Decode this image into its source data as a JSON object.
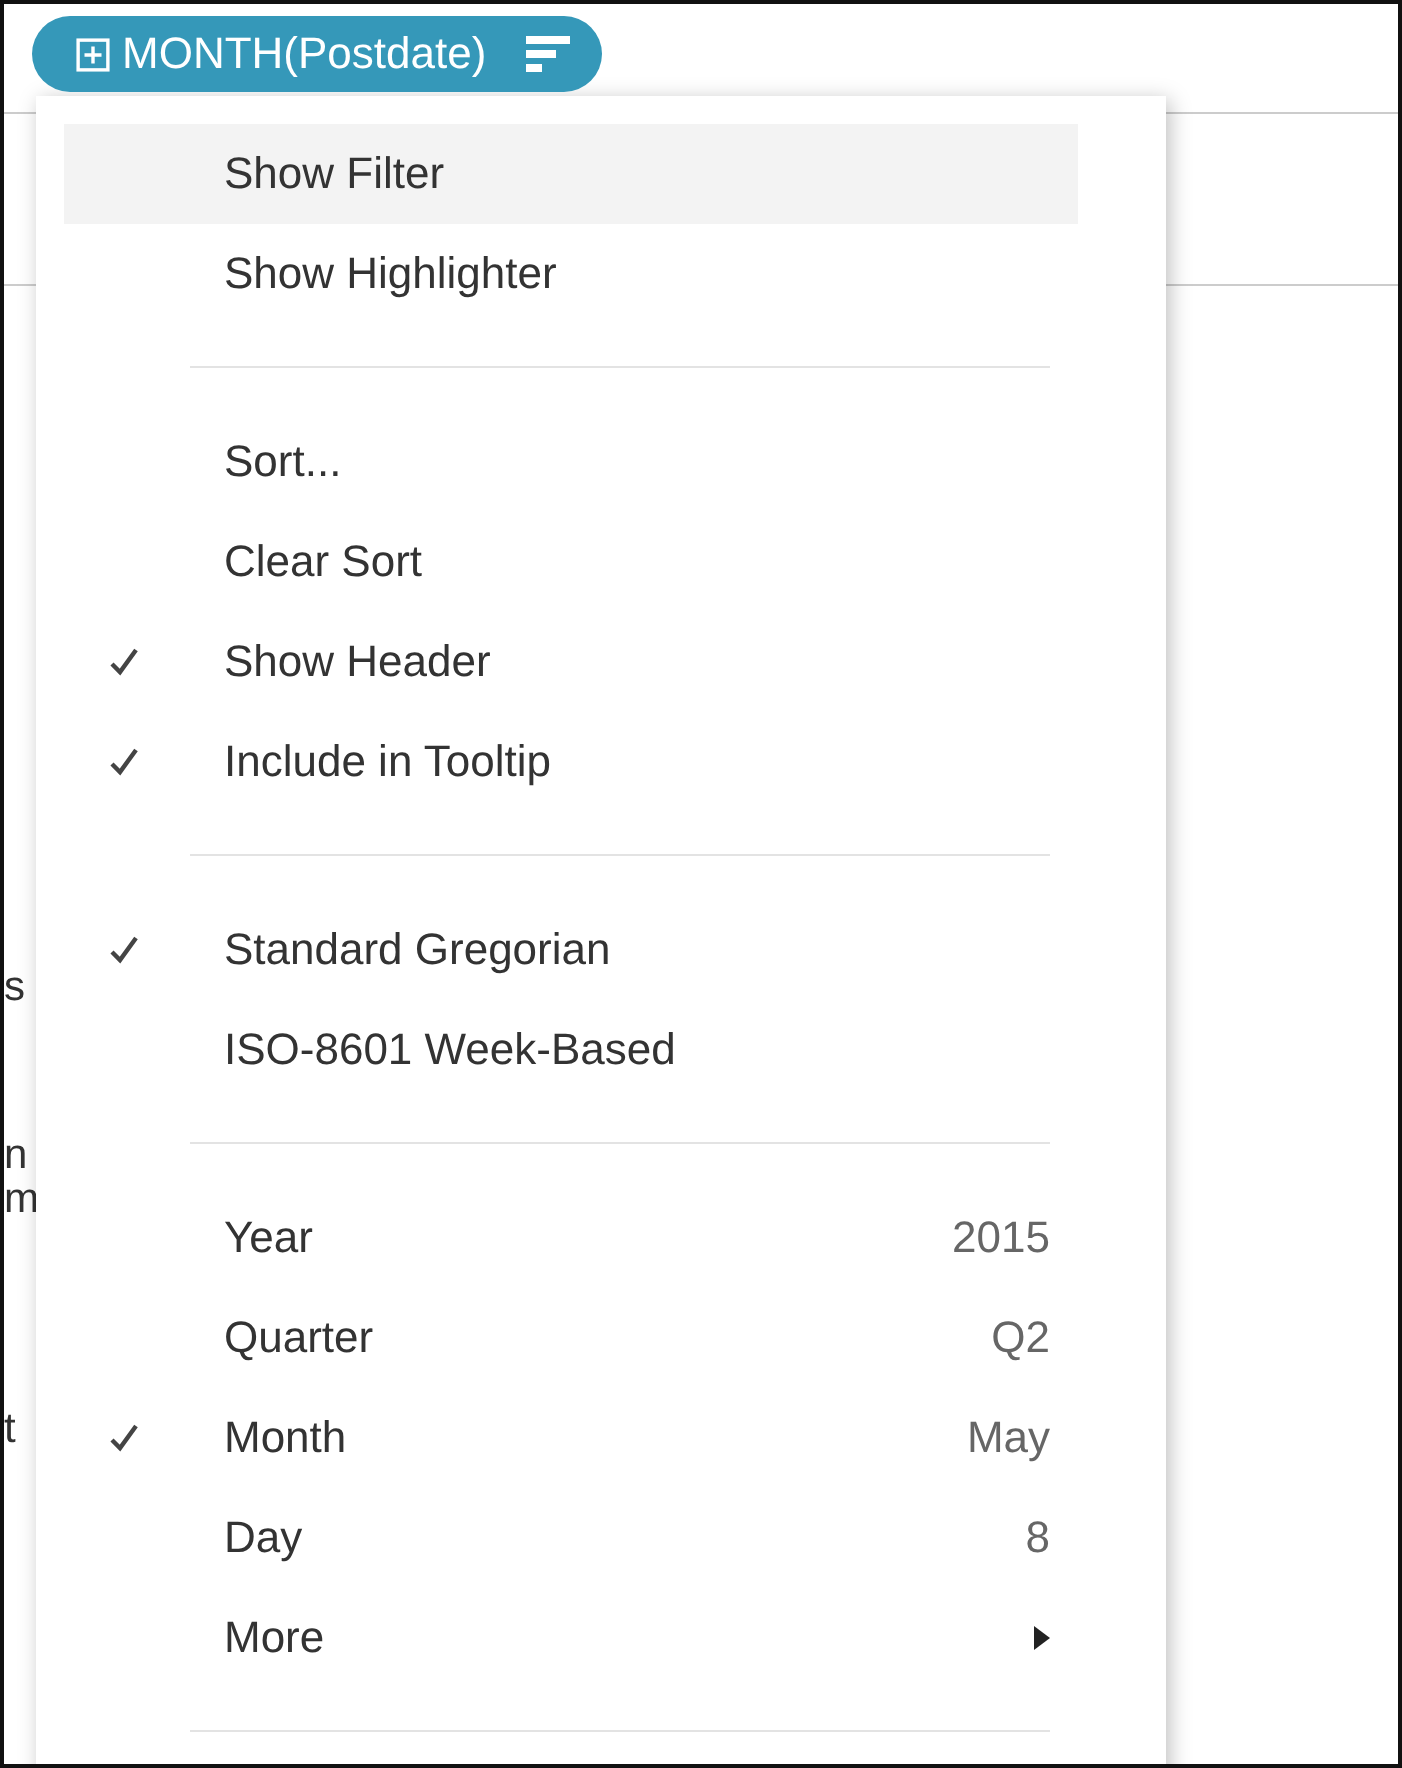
{
  "pill": {
    "label": "MONTH(Postdate)"
  },
  "background_fragments": [
    {
      "text": "s"
    },
    {
      "text": "n"
    },
    {
      "text": "m"
    },
    {
      "text": "t"
    }
  ],
  "menu": {
    "sections": [
      [
        {
          "label": "Show Filter",
          "kind": "option",
          "checked": false,
          "highlighted": true
        },
        {
          "label": "Show Highlighter",
          "kind": "option",
          "checked": false,
          "highlighted": false
        }
      ],
      [
        {
          "label": "Sort...",
          "kind": "option",
          "checked": false,
          "highlighted": false
        },
        {
          "label": "Clear Sort",
          "kind": "option",
          "checked": false,
          "highlighted": false
        },
        {
          "label": "Show Header",
          "kind": "option",
          "checked": true,
          "highlighted": false
        },
        {
          "label": "Include in Tooltip",
          "kind": "option",
          "checked": true,
          "highlighted": false
        }
      ],
      [
        {
          "label": "Standard Gregorian",
          "kind": "option",
          "checked": true,
          "highlighted": false
        },
        {
          "label": "ISO-8601 Week-Based",
          "kind": "option",
          "checked": false,
          "highlighted": false
        }
      ],
      [
        {
          "label": "Year",
          "kind": "option",
          "checked": false,
          "highlighted": false,
          "value": "2015"
        },
        {
          "label": "Quarter",
          "kind": "option",
          "checked": false,
          "highlighted": false,
          "value": "Q2"
        },
        {
          "label": "Month",
          "kind": "option",
          "checked": true,
          "highlighted": false,
          "value": "May"
        },
        {
          "label": "Day",
          "kind": "option",
          "checked": false,
          "highlighted": false,
          "value": "8"
        },
        {
          "label": "More",
          "kind": "submenu",
          "checked": false,
          "highlighted": false
        }
      ]
    ]
  }
}
